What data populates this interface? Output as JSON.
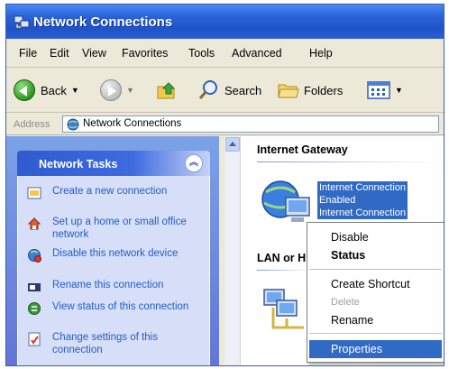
{
  "window": {
    "title": "Network Connections"
  },
  "menubar": {
    "items": [
      "File",
      "Edit",
      "View",
      "Favorites",
      "Tools",
      "Advanced",
      "Help"
    ]
  },
  "toolbar": {
    "back_label": "Back",
    "search_label": "Search",
    "folders_label": "Folders"
  },
  "address": {
    "label": "Address",
    "value": "Network Connections"
  },
  "tasks": {
    "title": "Network Tasks",
    "items": [
      {
        "label": "Create a new connection",
        "icon": "new-connection-icon"
      },
      {
        "label": "Set up a home or small office network",
        "icon": "home-network-icon"
      },
      {
        "label": "Disable this network device",
        "icon": "disable-device-icon"
      },
      {
        "label": "Rename this connection",
        "icon": "rename-icon"
      },
      {
        "label": "View status of this connection",
        "icon": "status-icon"
      },
      {
        "label": "Change settings of this connection",
        "icon": "settings-icon"
      }
    ]
  },
  "content": {
    "group1": "Internet Gateway",
    "gateway_lines": [
      "Internet Connection",
      "Enabled",
      "Internet Connection"
    ],
    "group2_partial": "LAN or H"
  },
  "context_menu": {
    "items": [
      "Disable",
      "Status",
      "Create Shortcut",
      "Delete",
      "Rename",
      "Properties"
    ]
  },
  "colors": {
    "title_blue": "#2a63d8",
    "selection": "#316ac5",
    "task_link": "#215dc6"
  }
}
